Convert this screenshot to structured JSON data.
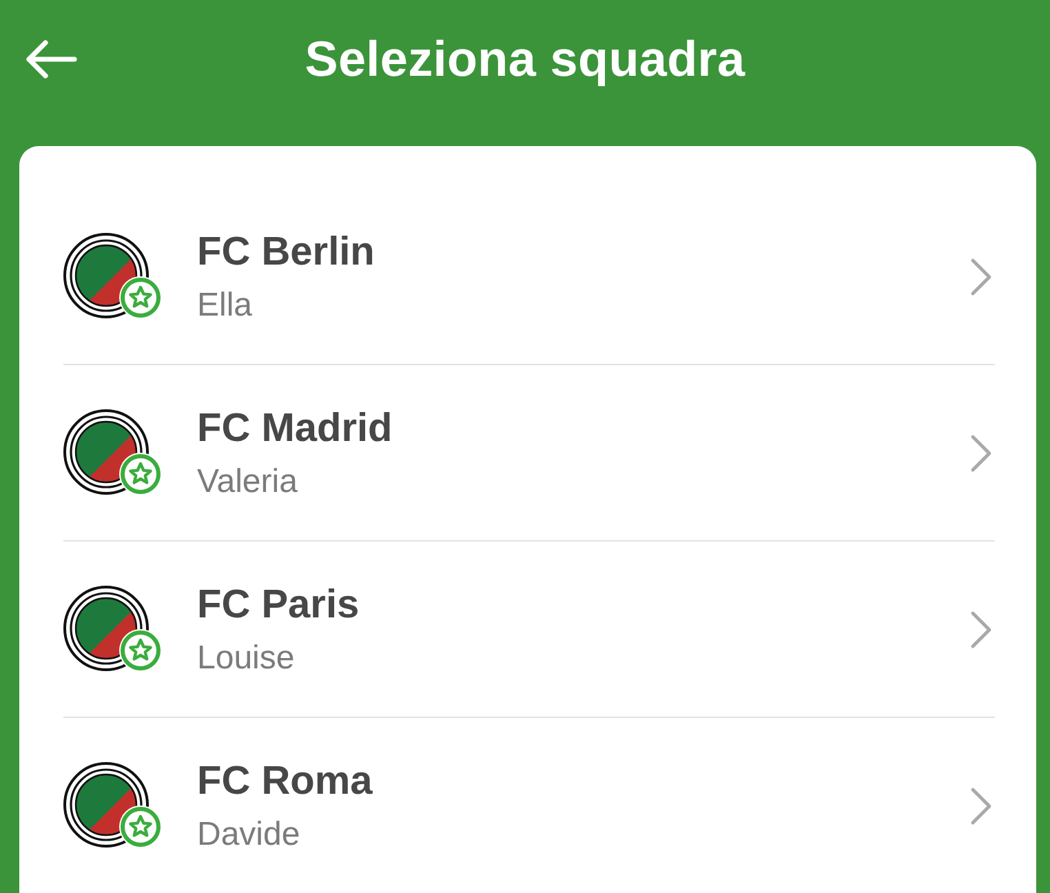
{
  "header": {
    "title": "Seleziona squadra"
  },
  "teams": [
    {
      "name": "FC Berlin",
      "manager": "Ella"
    },
    {
      "name": "FC Madrid",
      "manager": "Valeria"
    },
    {
      "name": "FC Paris",
      "manager": "Louise"
    },
    {
      "name": "FC Roma",
      "manager": "Davide"
    }
  ]
}
